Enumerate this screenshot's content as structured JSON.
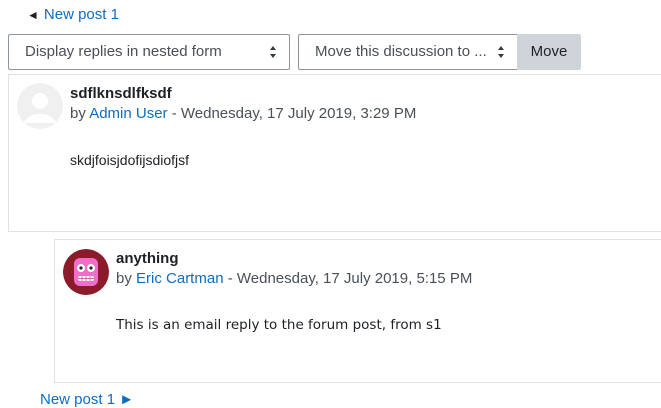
{
  "navigation": {
    "prev_arrow": "◄",
    "prev_link": "New post 1",
    "next_link": "New post 1 ►"
  },
  "controls": {
    "display_mode_selected": "Display replies in nested form",
    "move_select_selected": "Move this discussion to ...",
    "move_button": "Move"
  },
  "posts": [
    {
      "subject": "sdflknsdlfksdf",
      "by": "by",
      "author": "Admin User",
      "separator": " - ",
      "date": "Wednesday, 17 July 2019, 3:29 PM",
      "message": "skdjfoisjdofijsdiofjsf",
      "avatar": "default-user-avatar"
    },
    {
      "subject": "anything",
      "by": "by",
      "author": "Eric Cartman",
      "separator": " - ",
      "date": "Wednesday, 17 July 2019, 5:15 PM",
      "message": "This is an email reply to the forum post, from s1",
      "avatar": "pink-monster-avatar"
    }
  ],
  "colors": {
    "link": "#0f6cbf",
    "border": "#dee2e6",
    "button_bg": "#ced4da",
    "avatar2_bg": "#8b1a2b",
    "avatar2_face": "#f06ec8"
  }
}
